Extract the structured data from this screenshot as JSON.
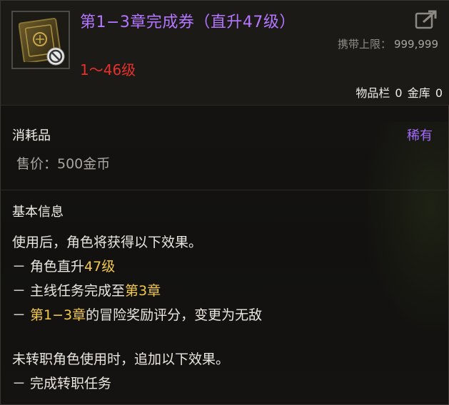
{
  "item": {
    "title": "第1−3章完成券（直升47级）",
    "level_range": "1～46级",
    "carry_limit_label": "携带上限：",
    "carry_limit_value": "999,999",
    "storage": {
      "inventory_label": "物品栏",
      "inventory_count": "0",
      "warehouse_label": "金库",
      "warehouse_count": "0"
    },
    "icon": "sealed-ticket-icon",
    "restriction_icon": "no-trade-icon"
  },
  "details": {
    "type": "消耗品",
    "rarity": "稀有",
    "rarity_color": "#a56bff",
    "price": "售价：500金币"
  },
  "info": {
    "title": "基本信息",
    "intro": "使用后，角色将获得以下效果。",
    "effect1_prefix": "－ 角色直升",
    "effect1_highlight": "47级",
    "effect2_prefix": "－ 主线任务完成至",
    "effect2_highlight": "第3章",
    "effect3_dash": "－ ",
    "effect3_highlight": "第1−3章",
    "effect3_suffix": "的冒险奖励评分，变更为无敌",
    "extra_intro": "未转职角色使用时，追加以下效果。",
    "extra_effect": "－ 完成转职任务",
    "highlight_color": "#f2c94a"
  }
}
